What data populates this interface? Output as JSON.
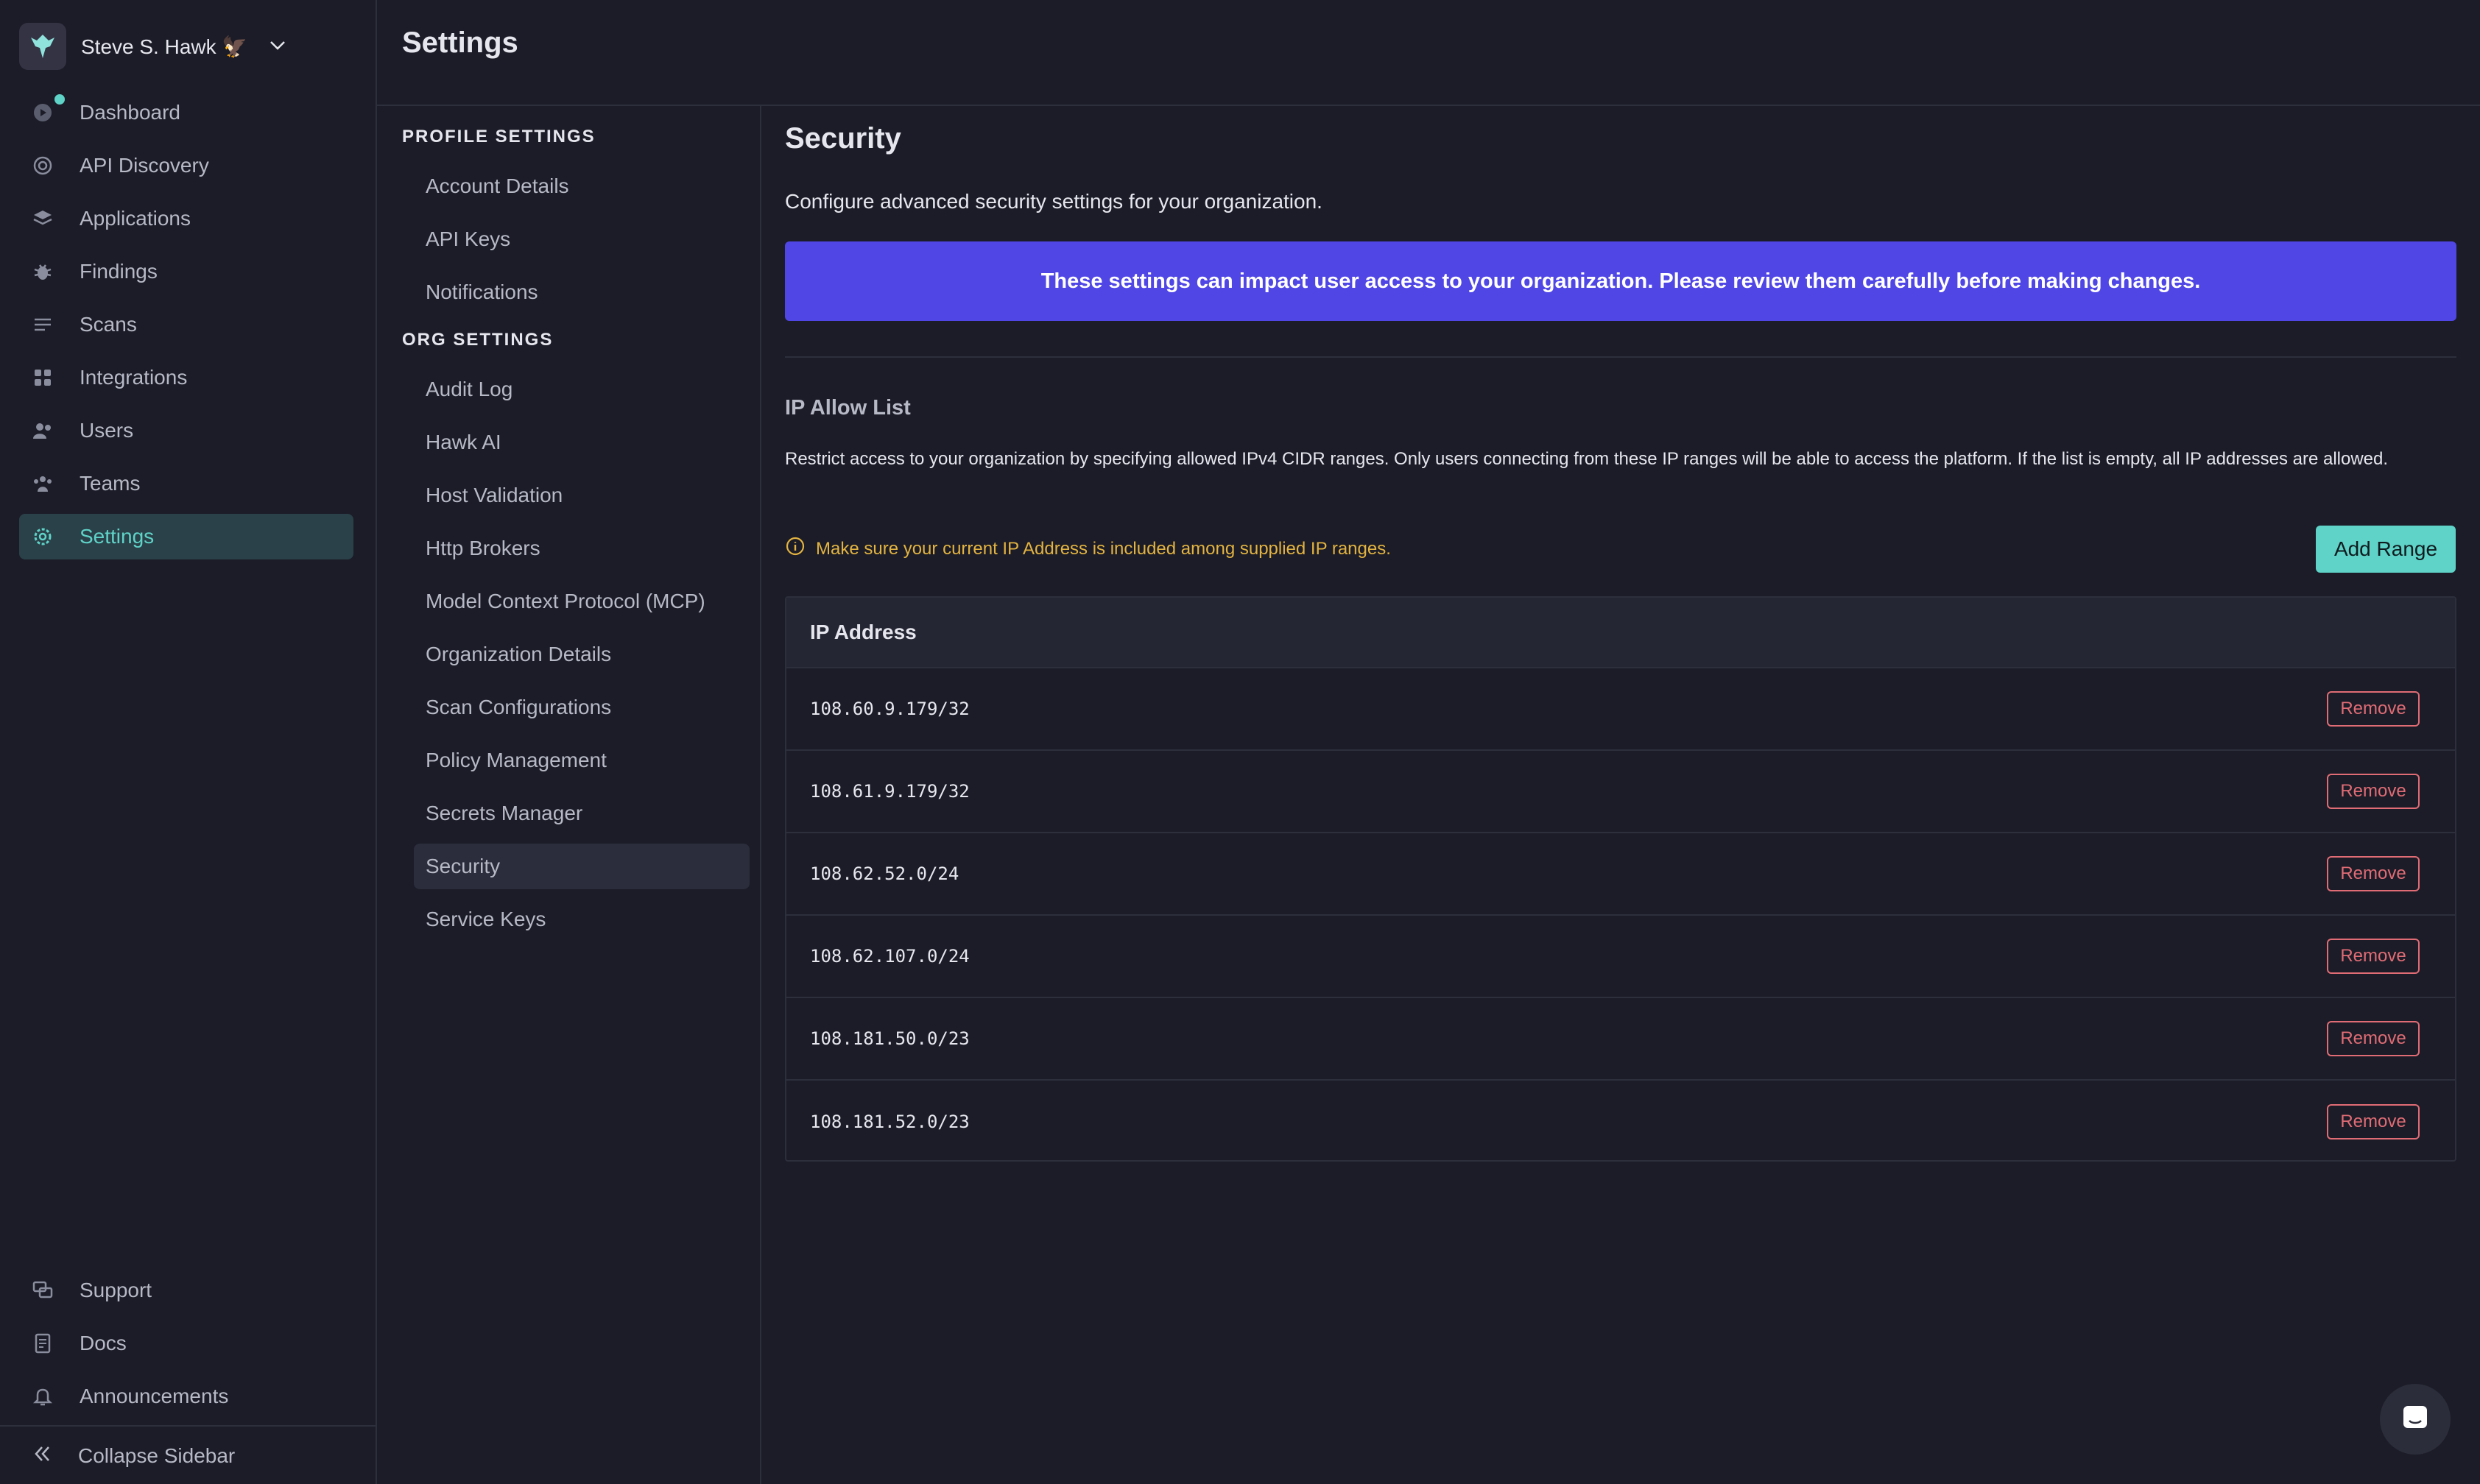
{
  "user": {
    "name": "Steve S. Hawk 🦅"
  },
  "page": {
    "title": "Settings"
  },
  "sidebar": {
    "items": [
      {
        "label": "Dashboard",
        "icon": "dashboard-icon"
      },
      {
        "label": "API Discovery",
        "icon": "api-discovery-icon"
      },
      {
        "label": "Applications",
        "icon": "applications-icon"
      },
      {
        "label": "Findings",
        "icon": "bug-icon"
      },
      {
        "label": "Scans",
        "icon": "list-icon"
      },
      {
        "label": "Integrations",
        "icon": "integrations-icon"
      },
      {
        "label": "Users",
        "icon": "users-icon"
      },
      {
        "label": "Teams",
        "icon": "teams-icon"
      },
      {
        "label": "Settings",
        "icon": "gear-icon",
        "active": true
      }
    ],
    "bottom_items": [
      {
        "label": "Support",
        "icon": "support-icon"
      },
      {
        "label": "Docs",
        "icon": "docs-icon"
      },
      {
        "label": "Announcements",
        "icon": "bell-icon"
      }
    ],
    "collapse_label": "Collapse Sidebar"
  },
  "settings_nav": {
    "profile_title": "PROFILE SETTINGS",
    "profile_items": [
      "Account Details",
      "API Keys",
      "Notifications"
    ],
    "org_title": "ORG SETTINGS",
    "org_items": [
      "Audit Log",
      "Hawk AI",
      "Host Validation",
      "Http Brokers",
      "Model Context Protocol (MCP)",
      "Organization Details",
      "Scan Configurations",
      "Policy Management",
      "Secrets Manager",
      "Security",
      "Service Keys"
    ],
    "active": "Security"
  },
  "security": {
    "title": "Security",
    "description": "Configure advanced security settings for your organization.",
    "banner": "These settings can impact user access to your organization. Please review them carefully before making changes.",
    "ip_allow_title": "IP Allow List",
    "ip_allow_desc": "Restrict access to your organization by specifying allowed IPv4 CIDR ranges. Only users connecting from these IP ranges will be able to access the platform. If the list is empty, all IP addresses are allowed.",
    "warning": "Make sure your current IP Address is included among supplied IP ranges.",
    "add_range_label": "Add Range",
    "table_header": "IP Address",
    "remove_label": "Remove",
    "ip_ranges": [
      "108.60.9.179/32",
      "108.61.9.179/32",
      "108.62.52.0/24",
      "108.62.107.0/24",
      "108.181.50.0/23",
      "108.181.52.0/23"
    ]
  },
  "colors": {
    "accent": "#5fd3c8",
    "banner": "#4f46e5",
    "warning": "#e3b341",
    "danger": "#e06c75"
  }
}
